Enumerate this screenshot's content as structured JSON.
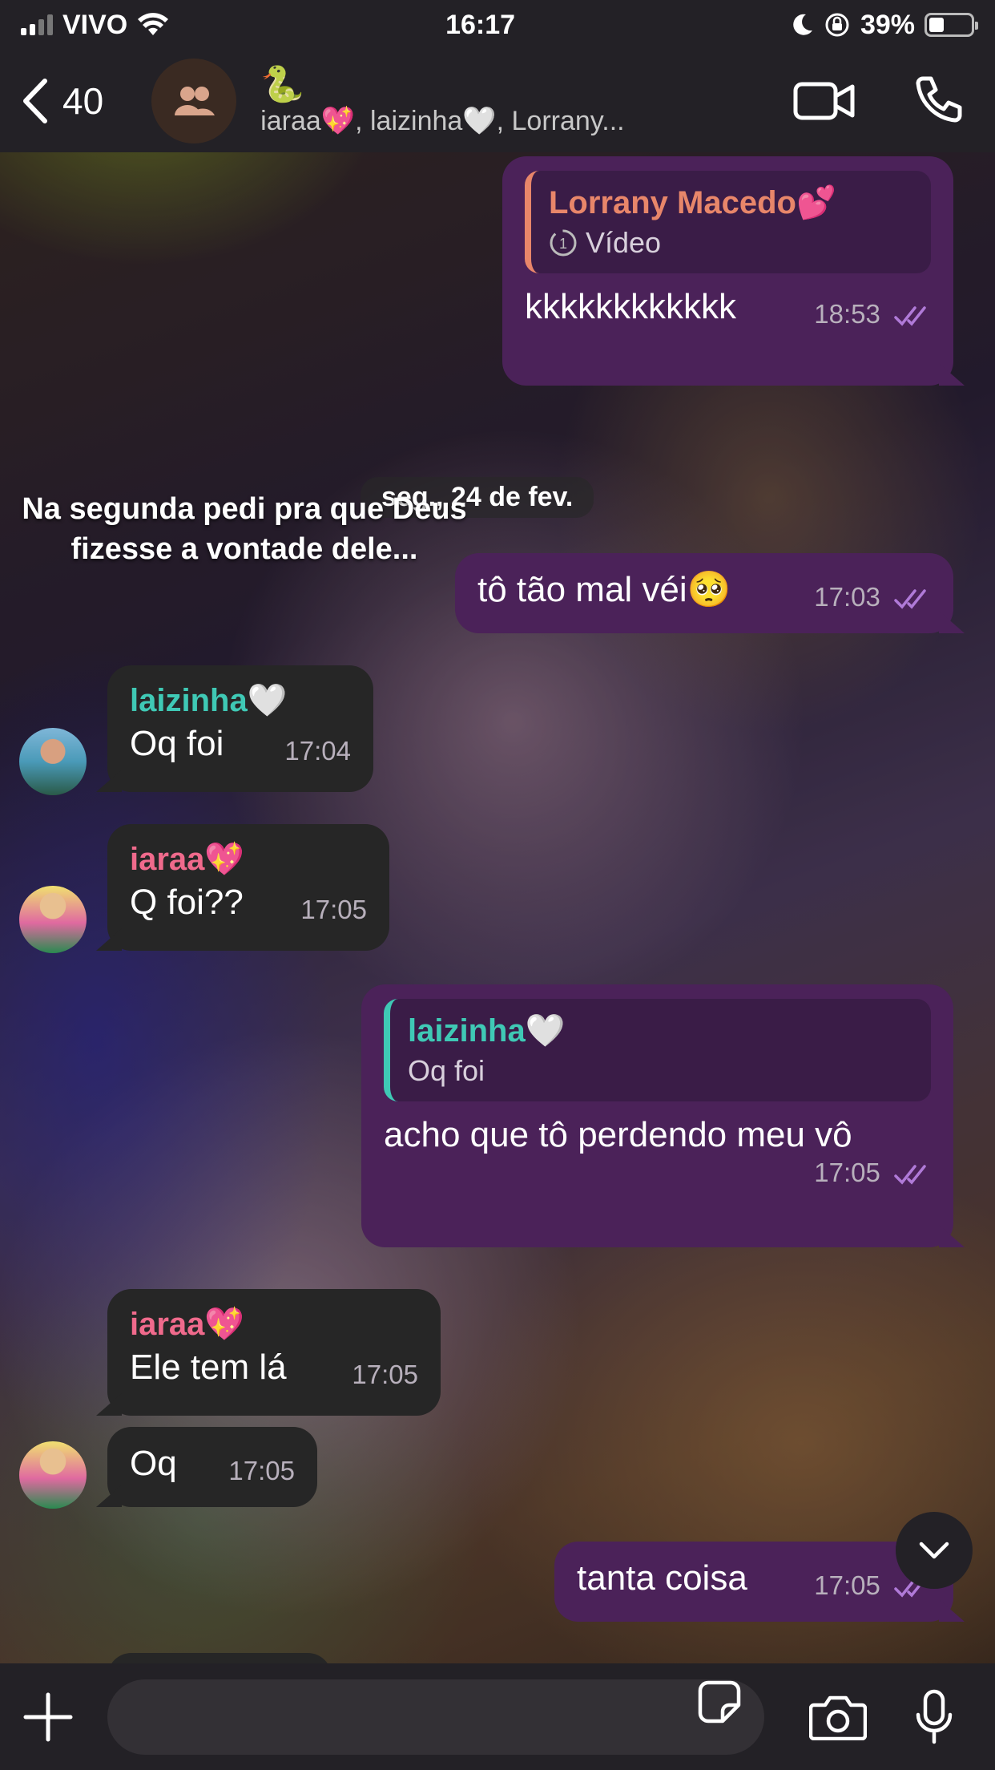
{
  "status_bar": {
    "carrier": "VIVO",
    "time": "16:17",
    "battery": "39%",
    "battery_level": 0.39
  },
  "header": {
    "back_count": "40",
    "group_emoji": "🐍",
    "members": "iaraa💖, laizinha🤍, Lorrany..."
  },
  "overlay_caption": "Na segunda pedi pra que Deus fizesse a vontade dele...",
  "date_separator": "seg., 24 de fev.",
  "messages": [
    {
      "direction": "out",
      "reply": {
        "sender": "Lorrany Macedo💕",
        "text": "Vídeo",
        "icon": "video-once-icon",
        "accent": "#e8866a"
      },
      "text": "kkkkkkkkkkkk",
      "time": "18:53"
    },
    {
      "direction": "out",
      "text": "tô tão mal véi🥺",
      "time": "17:03"
    },
    {
      "direction": "in",
      "sender": "laizinha🤍",
      "sender_color": "#3fc9b5",
      "text": "Oq foi",
      "time": "17:04"
    },
    {
      "direction": "in",
      "sender": "iaraa💖",
      "sender_color": "#f06a8c",
      "text": "Q foi??",
      "time": "17:05"
    },
    {
      "direction": "out",
      "reply": {
        "sender": "laizinha🤍",
        "text": "Oq foi",
        "accent": "#3fc9b5"
      },
      "text": "acho que tô perdendo meu vô",
      "time": "17:05"
    },
    {
      "direction": "in",
      "sender": "iaraa💖",
      "sender_color": "#f06a8c",
      "text": "Ele tem lá",
      "time": "17:05"
    },
    {
      "direction": "in",
      "text": "Oq",
      "time": "17:05"
    },
    {
      "direction": "out",
      "text": "tanta coisa",
      "time": "17:05"
    }
  ],
  "input": {
    "placeholder": ""
  },
  "colors": {
    "outgoing_bubble": "#4b2259",
    "incoming_bubble": "#262626",
    "read_ticks": "#b07ad8",
    "bar_background": "#232126"
  }
}
